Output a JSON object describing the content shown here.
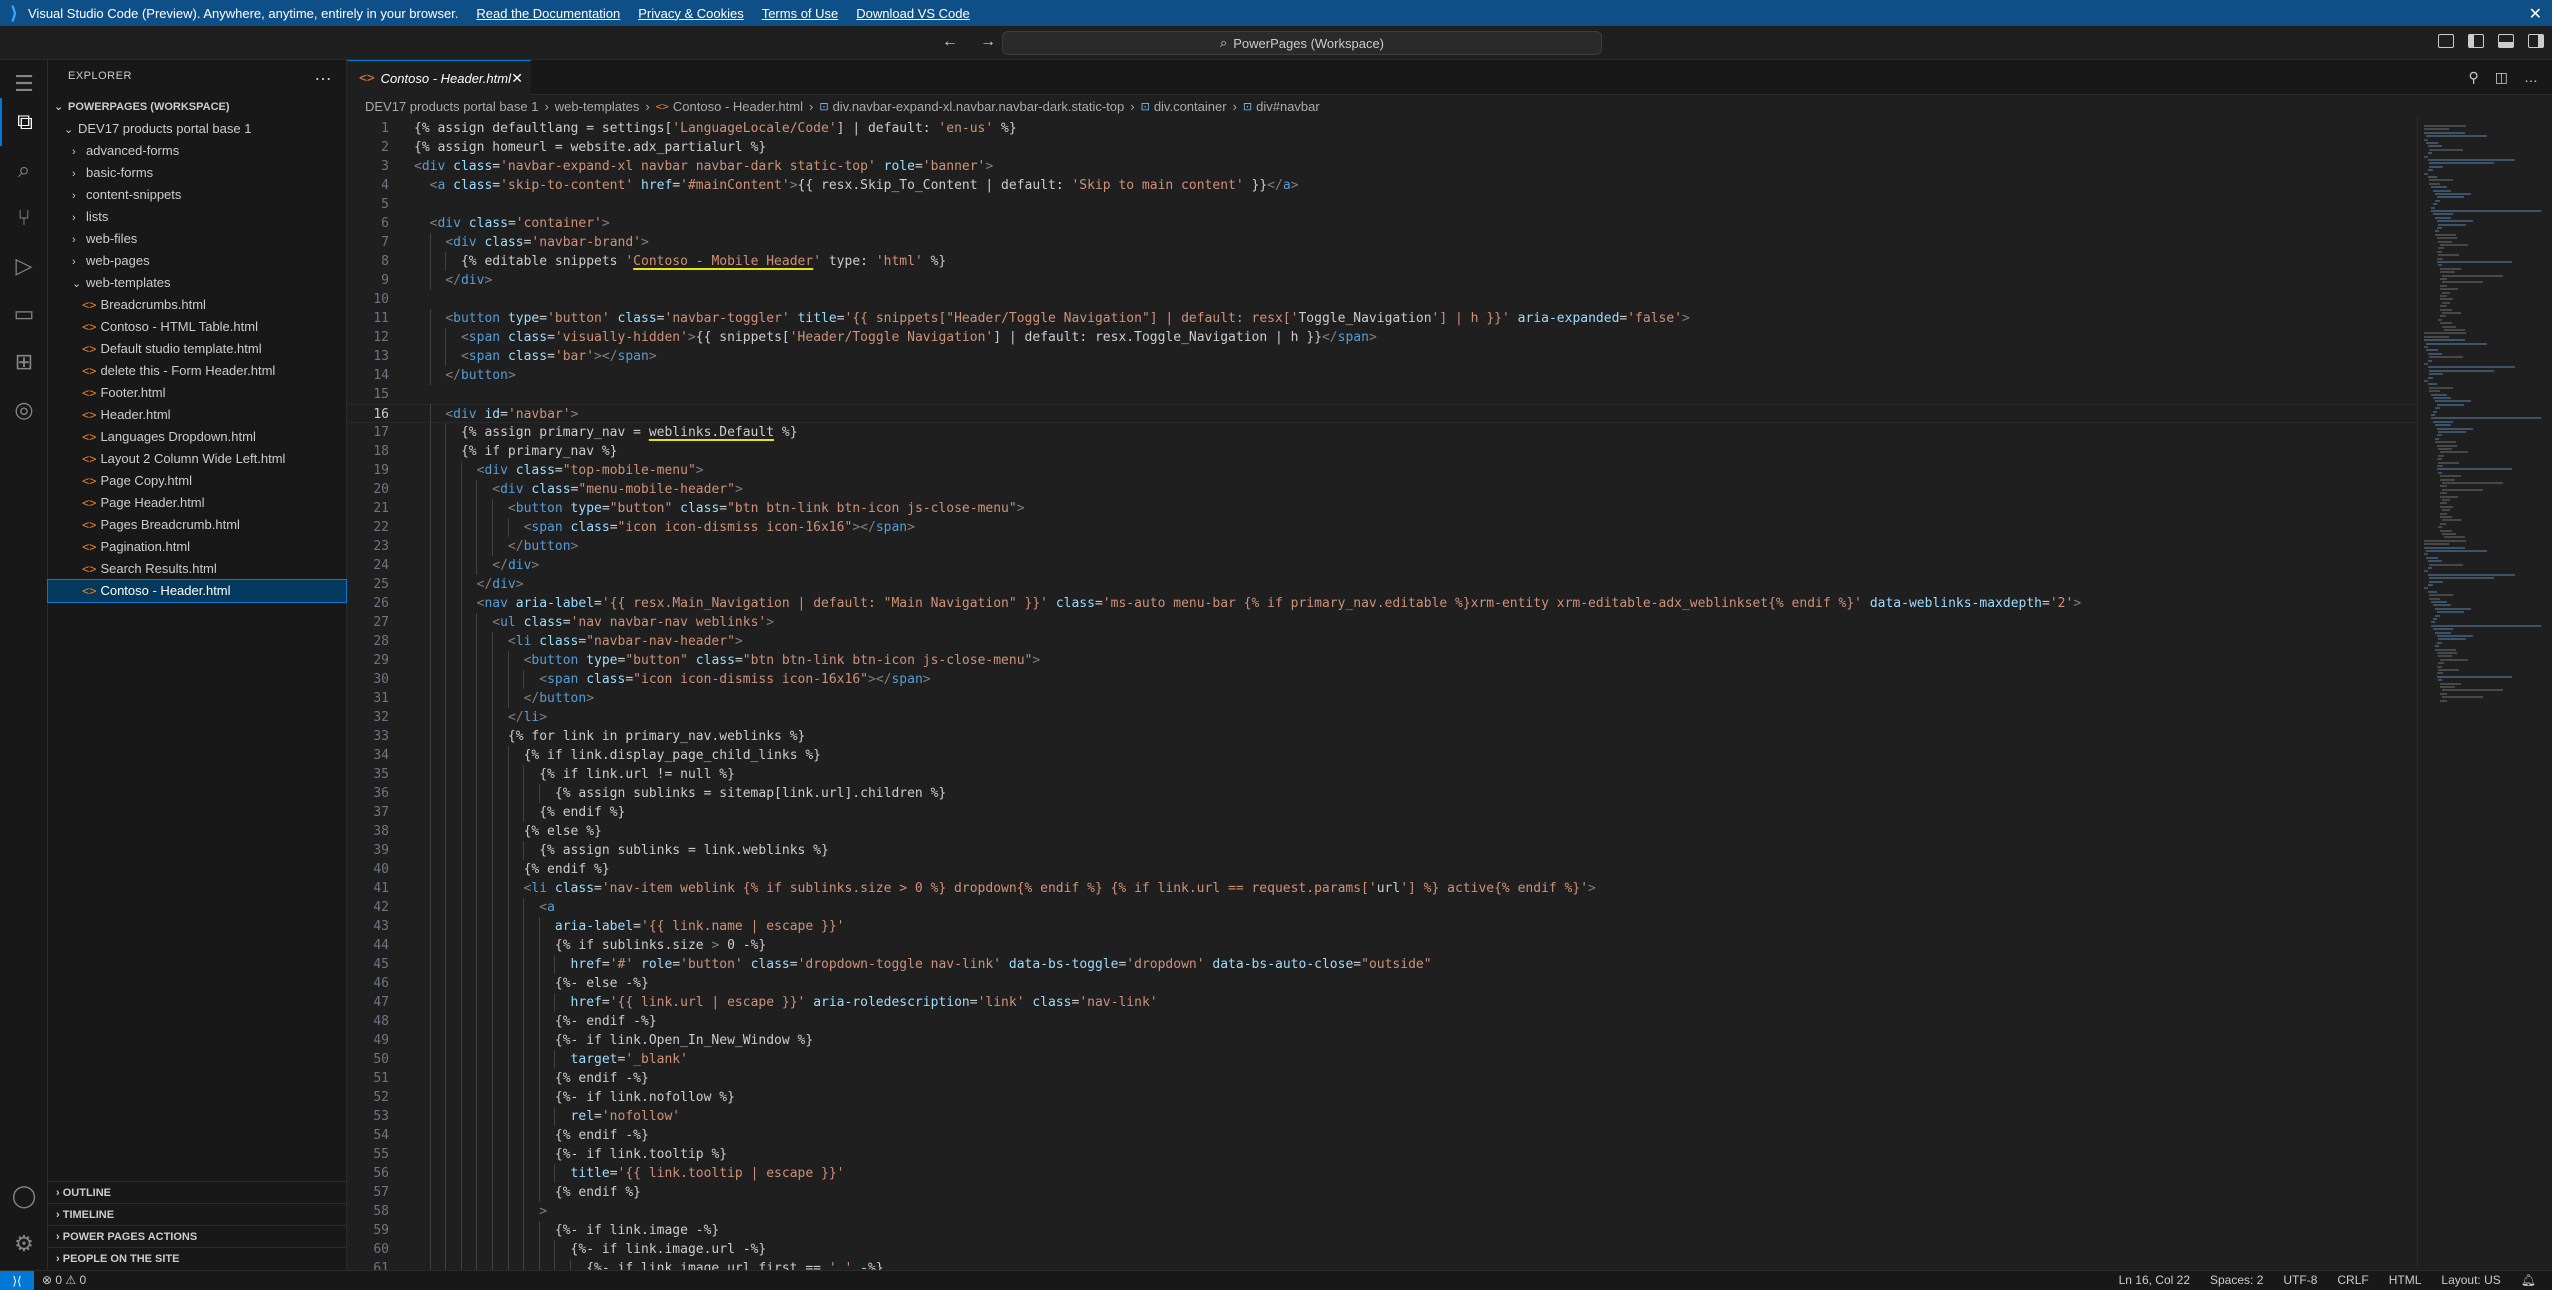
{
  "banner": {
    "text": "Visual Studio Code (Preview). Anywhere, anytime, entirely in your browser.",
    "links": [
      "Read the Documentation",
      "Privacy & Cookies",
      "Terms of Use",
      "Download VS Code"
    ]
  },
  "titlebar": {
    "command_center": "PowerPages (Workspace)"
  },
  "sidebar": {
    "title": "EXPLORER",
    "workspace": "POWERPAGES (WORKSPACE)",
    "root": "DEV17 products portal base 1",
    "folders": [
      "advanced-forms",
      "basic-forms",
      "content-snippets",
      "lists",
      "web-files",
      "web-pages",
      "web-templates"
    ],
    "files": [
      "Breadcrumbs.html",
      "Contoso - HTML Table.html",
      "Default studio template.html",
      "delete this  - Form Header.html",
      "Footer.html",
      "Header.html",
      "Languages Dropdown.html",
      "Layout 2 Column Wide Left.html",
      "Page Copy.html",
      "Page Header.html",
      "Pages Breadcrumb.html",
      "Pagination.html",
      "Search Results.html",
      "Contoso - Header.html"
    ],
    "panels": [
      "OUTLINE",
      "TIMELINE",
      "POWER PAGES ACTIONS",
      "PEOPLE ON THE SITE"
    ]
  },
  "editor": {
    "tab_label": "Contoso - Header.html",
    "breadcrumb": [
      "DEV17 products portal base 1",
      "web-templates",
      "Contoso - Header.html",
      "div.navbar-expand-xl.navbar.navbar-dark.static-top",
      "div.container",
      "div#navbar"
    ],
    "lines": [
      "{% assign defaultlang = settings['LanguageLocale/Code'] | default: 'en-us' %}",
      "{% assign homeurl = website.adx_partialurl %}",
      "<div class='navbar-expand-xl navbar navbar-dark static-top' role='banner'>",
      "  <a class='skip-to-content' href='#mainContent'>{{ resx.Skip_To_Content | default: 'Skip to main content' }}</a>",
      "",
      "  <div class='container'>",
      "    <div class='navbar-brand'>",
      "      {% editable snippets 'Contoso - Mobile Header' type: 'html' %}",
      "    </div>",
      "",
      "    <button type='button' class='navbar-toggler' title='{{ snippets[\"Header/Toggle Navigation\"] | default: resx['Toggle_Navigation'] | h }}' aria-expanded='false'>",
      "      <span class='visually-hidden'>{{ snippets['Header/Toggle Navigation'] | default: resx.Toggle_Navigation | h }}</span>",
      "      <span class='bar'></span>",
      "    </button>",
      "",
      "    <div id='navbar'>",
      "      {% assign primary_nav = weblinks.Default %}",
      "      {% if primary_nav %}",
      "        <div class=\"top-mobile-menu\">",
      "          <div class=\"menu-mobile-header\">",
      "            <button type=\"button\" class=\"btn btn-link btn-icon js-close-menu\">",
      "              <span class=\"icon icon-dismiss icon-16x16\"></span>",
      "            </button>",
      "          </div>",
      "        </div>",
      "        <nav aria-label='{{ resx.Main_Navigation | default: \"Main Navigation\" }}' class='ms-auto menu-bar {% if primary_nav.editable %}xrm-entity xrm-editable-adx_weblinkset{% endif %}' data-weblinks-maxdepth='2'>",
      "          <ul class='nav navbar-nav weblinks'>",
      "            <li class=\"navbar-nav-header\">",
      "              <button type=\"button\" class=\"btn btn-link btn-icon js-close-menu\">",
      "                <span class=\"icon icon-dismiss icon-16x16\"></span>",
      "              </button>",
      "            </li>",
      "            {% for link in primary_nav.weblinks %}",
      "              {% if link.display_page_child_links %}",
      "                {% if link.url != null %}",
      "                  {% assign sublinks = sitemap[link.url].children %}",
      "                {% endif %}",
      "              {% else %}",
      "                {% assign sublinks = link.weblinks %}",
      "              {% endif %}",
      "              <li class='nav-item weblink {% if sublinks.size > 0 %} dropdown{% endif %} {% if link.url == request.params['url'] %} active{% endif %}'>",
      "                <a",
      "                  aria-label='{{ link.name | escape }}'",
      "                  {% if sublinks.size > 0 -%}",
      "                    href='#' role='button' class='dropdown-toggle nav-link' data-bs-toggle='dropdown' data-bs-auto-close=\"outside\"",
      "                  {%- else -%}",
      "                    href='{{ link.url | escape }}' aria-roledescription='link' class='nav-link'",
      "                  {%- endif -%}",
      "                  {%- if link.Open_In_New_Window %}",
      "                    target='_blank'",
      "                  {% endif -%}",
      "                  {%- if link.nofollow %}",
      "                    rel='nofollow'",
      "                  {% endif -%}",
      "                  {%- if link.tooltip %}",
      "                    title='{{ link.tooltip | escape }}'",
      "                  {% endif %}",
      "                >",
      "                  {%- if link.image -%}",
      "                    {%- if link.image.url -%}",
      "                      {%- if link.image.url.first == '.' -%}"
    ]
  },
  "statusbar": {
    "problems": "⊗ 0 ⚠ 0",
    "items": [
      "Ln 16, Col 22",
      "Spaces: 2",
      "UTF-8",
      "CRLF",
      "HTML",
      "Layout: US"
    ]
  },
  "colors": {
    "accent": "#0078d4",
    "banner": "#0e4f88",
    "html_icon": "#e37933"
  }
}
